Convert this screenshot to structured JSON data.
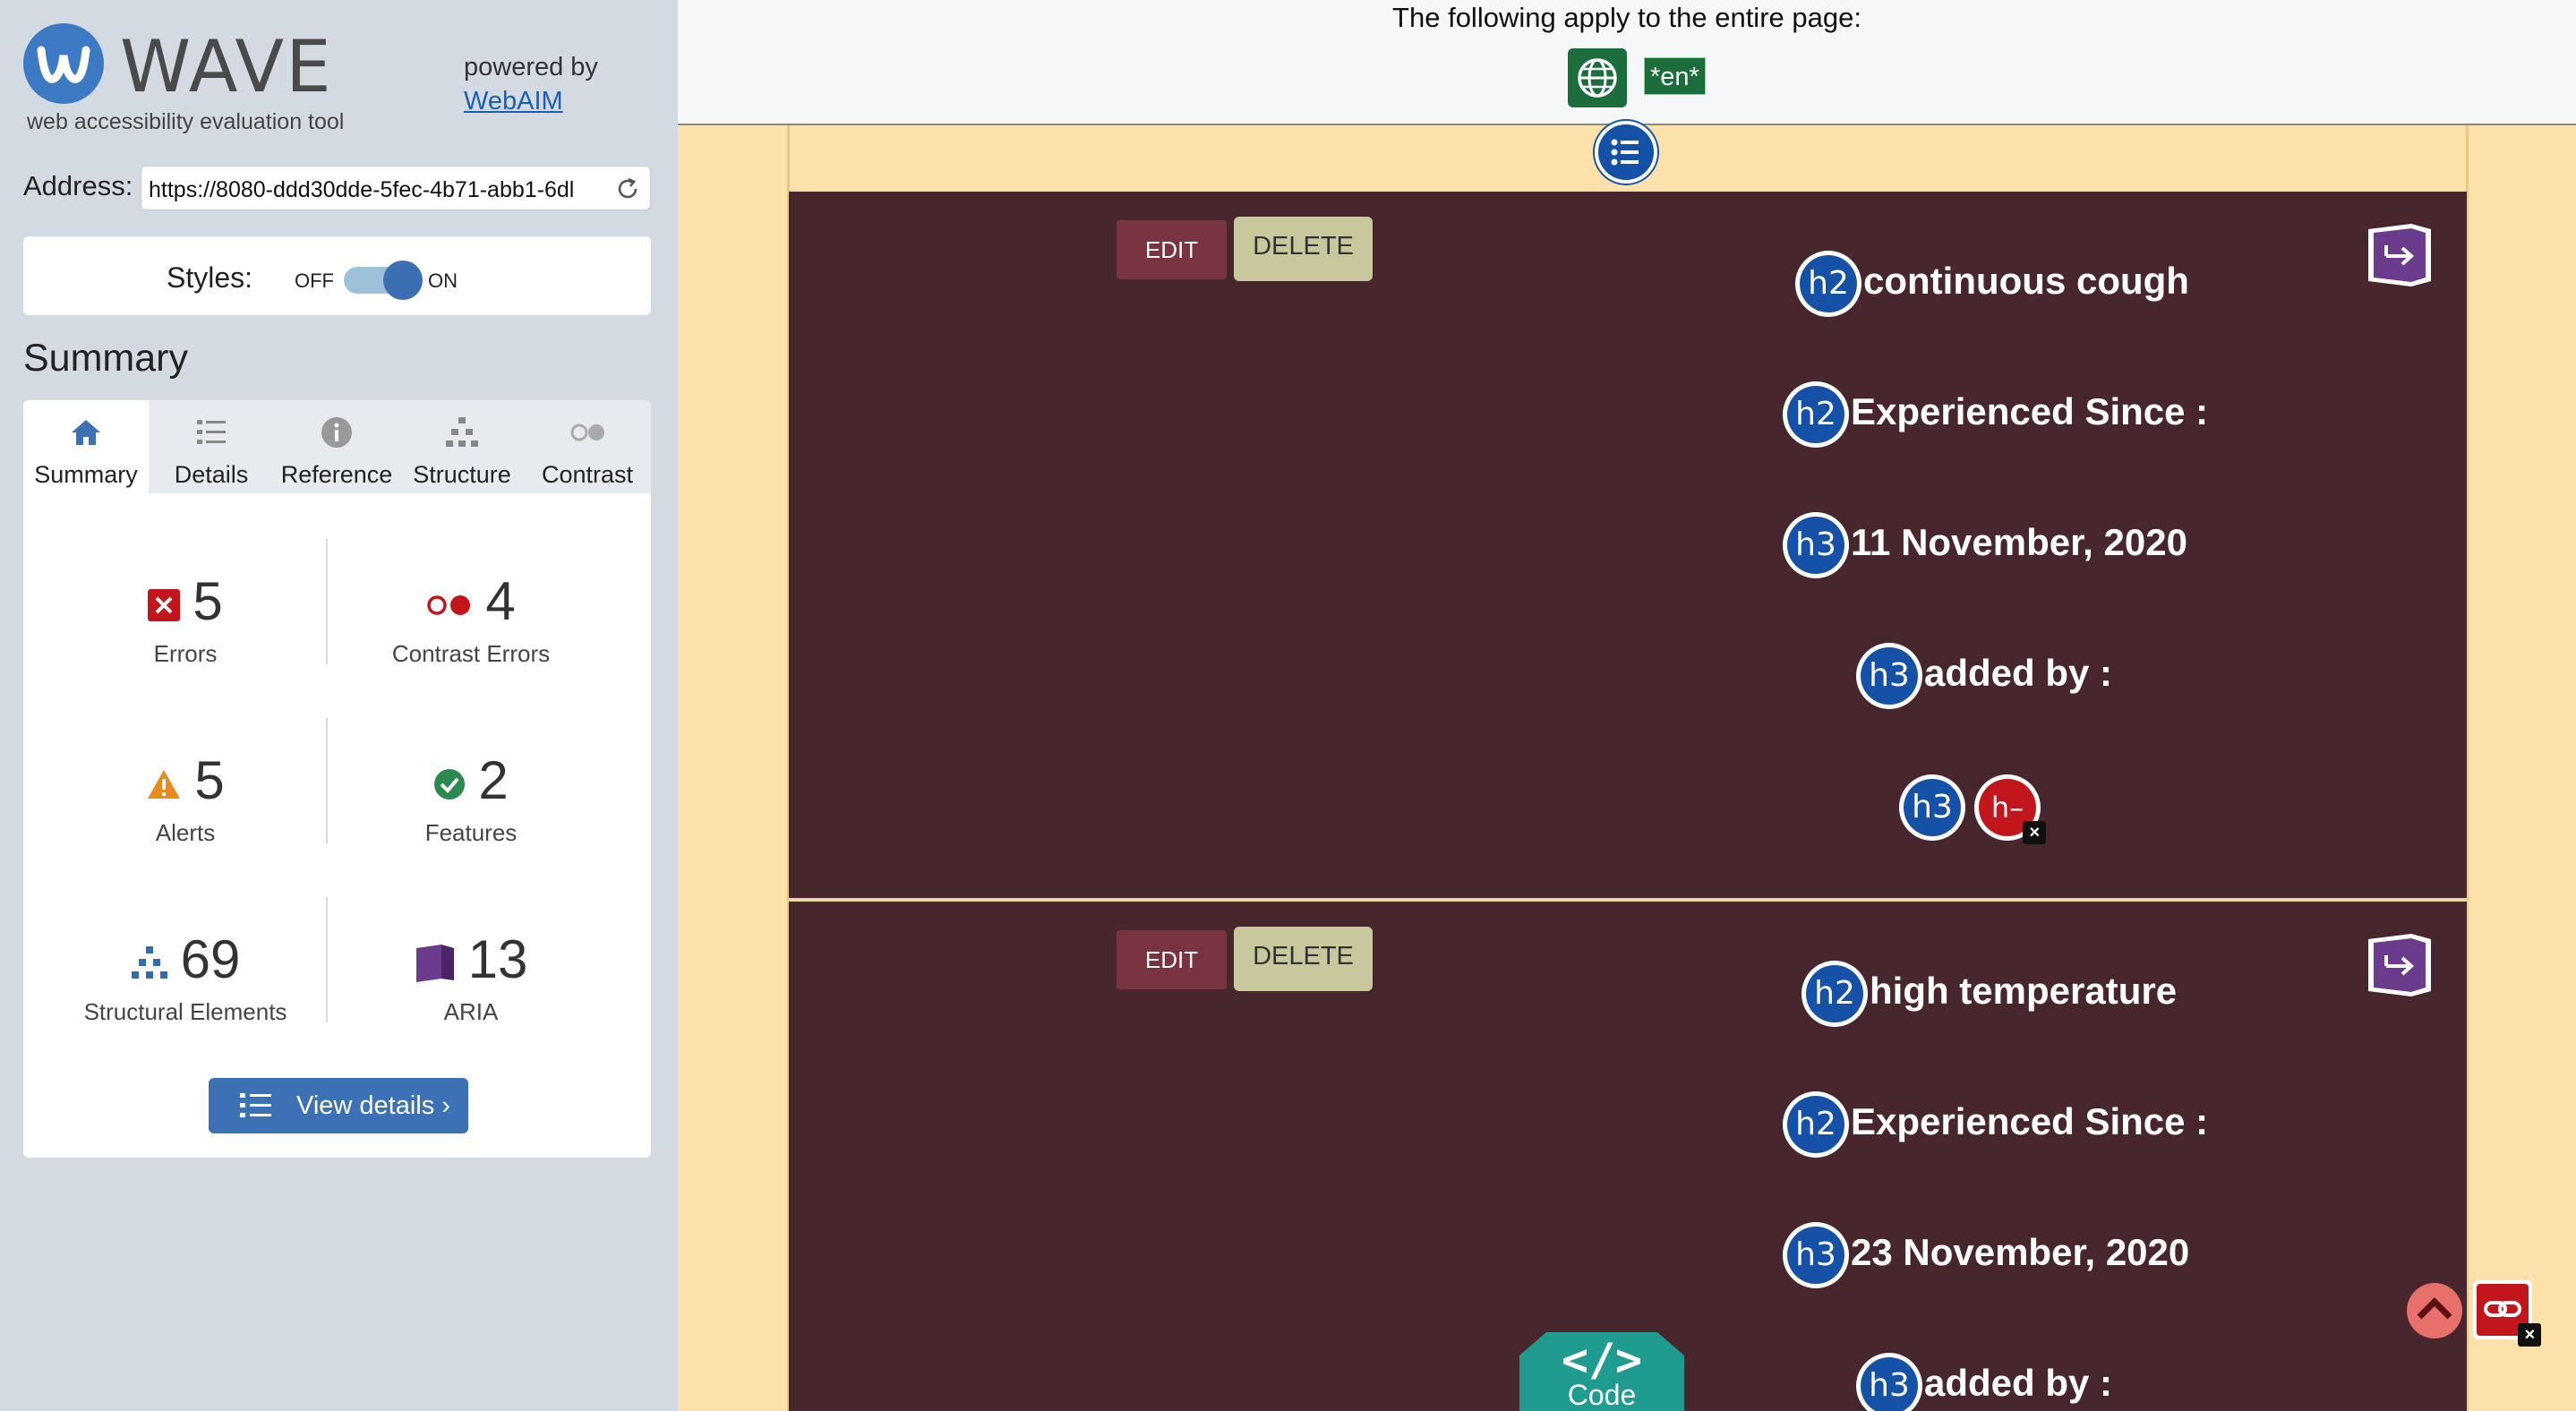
{
  "wave": {
    "name": "WAVE",
    "tagline": "web accessibility evaluation tool",
    "powered_by": "powered by",
    "webaim_link": "WebAIM",
    "address_label": "Address:",
    "address_value": "https://8080-ddd30dde-5fec-4b71-abb1-6dl",
    "styles_label": "Styles:",
    "styles_off": "OFF",
    "styles_on": "ON",
    "styles_state": "on",
    "summary_title": "Summary",
    "tabs": [
      {
        "label": "Summary",
        "icon": "home-icon",
        "active": true
      },
      {
        "label": "Details",
        "icon": "list-icon",
        "active": false
      },
      {
        "label": "Reference",
        "icon": "info-icon",
        "active": false
      },
      {
        "label": "Structure",
        "icon": "hierarchy-icon",
        "active": false
      },
      {
        "label": "Contrast",
        "icon": "contrast-icon",
        "active": false
      }
    ],
    "stats": {
      "errors": {
        "count": "5",
        "label": "Errors"
      },
      "contrast_errors": {
        "count": "4",
        "label": "Contrast Errors"
      },
      "alerts": {
        "count": "5",
        "label": "Alerts"
      },
      "features": {
        "count": "2",
        "label": "Features"
      },
      "structural": {
        "count": "69",
        "label": "Structural Elements"
      },
      "aria": {
        "count": "13",
        "label": "ARIA"
      }
    },
    "view_details": "View details ›"
  },
  "page": {
    "topbar_text": "The following apply to the entire page:",
    "lang_badge": "*en*",
    "cards": [
      {
        "edit": "EDIT",
        "delete": "DELETE",
        "headings": [
          {
            "level": "h2",
            "text": "continuous cough"
          },
          {
            "level": "h2",
            "text": "Experienced Since :"
          },
          {
            "level": "h3",
            "text": "11 November, 2020"
          },
          {
            "level": "h3",
            "text": "added by :"
          }
        ],
        "empty_heading": {
          "level": "h3",
          "error_badge": "h–"
        }
      },
      {
        "edit": "EDIT",
        "delete": "DELETE",
        "headings": [
          {
            "level": "h2",
            "text": "high temperature"
          },
          {
            "level": "h2",
            "text": "Experienced Since :"
          },
          {
            "level": "h3",
            "text": "23 November, 2020"
          },
          {
            "level": "h3",
            "text": "added by :"
          }
        ]
      }
    ],
    "code_button": "Code",
    "code_glyph": "</>"
  },
  "colors": {
    "card_bg": "#47272d",
    "page_bg": "#fde1ab",
    "wave_blue": "#3c7bc4",
    "heading_badge": "#1451a7",
    "error_red": "#c3161c"
  }
}
